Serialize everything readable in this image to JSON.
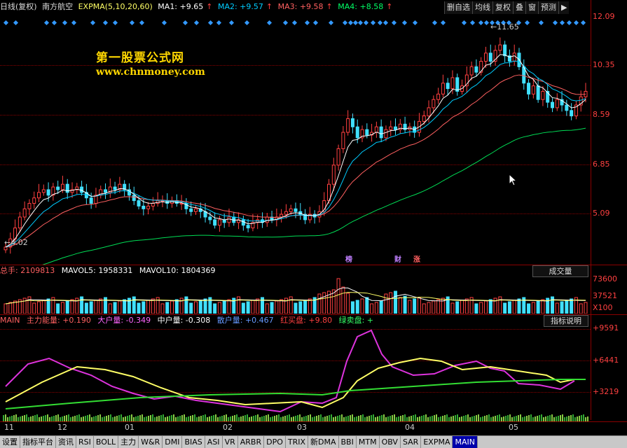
{
  "header": {
    "period": "日线(复权)",
    "stock": "南方航空",
    "indicator": "EXPMA(5,10,20,60)",
    "ma1": "MA1: +9.65",
    "ma2": "MA2: +9.57",
    "ma3": "MA3: +9.58",
    "ma4": "MA4: +8.58",
    "colors": {
      "ma1": "#ffffff",
      "ma2": "#00ccff",
      "ma3": "#ff6060",
      "ma4": "#00ff66"
    }
  },
  "toolbar": {
    "buttons": [
      "删自选",
      "均线",
      "复权",
      "叠",
      "窗",
      "预测"
    ],
    "arrow": "▶"
  },
  "watermark": {
    "line1": "第一股票公式网",
    "line2": "www.chnmoney.com"
  },
  "price_axis": {
    "ticks": [
      "12.09",
      "10.35",
      "8.59",
      "6.85",
      "5.09"
    ]
  },
  "price_annotations": {
    "high": "11.65",
    "low": "4.02"
  },
  "event_markers": [
    {
      "text": "榜",
      "color": "#c080ff"
    },
    {
      "text": "财",
      "color": "#c080ff"
    },
    {
      "text": "涨",
      "color": "#ff6060"
    }
  ],
  "volume_panel": {
    "total": "总手: 2109813",
    "mavol5": "MAVOL5: 1958331",
    "mavol10": "MAVOL10: 1804369",
    "dropdown": "成交量",
    "ticks": [
      "73600",
      "37521",
      "X100"
    ]
  },
  "main_panel": {
    "name": "MAIN",
    "i1": "主力能量: +0.190",
    "i2": "大户量: -0.349",
    "i3": "中户量: -0.308",
    "i4": "散户量: +0.467",
    "i5": "红买盘: +9.80",
    "i6": "绿卖盘: +",
    "button": "指标说明",
    "ticks": [
      "+9591",
      "+6441",
      "+3219"
    ]
  },
  "x_axis": {
    "labels": [
      "11",
      "12",
      "01",
      "02",
      "03",
      "04",
      "05"
    ]
  },
  "bottom_tabs": [
    "设置",
    "指标平台",
    "资讯",
    "RSI",
    "BOLL",
    "主力",
    "W&R",
    "DMI",
    "BIAS",
    "ASI",
    "VR",
    "ARBR",
    "DPO",
    "TRIX",
    "新DMA",
    "BBI",
    "MTM",
    "OBV",
    "SAR",
    "EXPMA",
    "MAIN"
  ],
  "chart_data": [
    {
      "type": "candlestick",
      "title": "",
      "ylim": [
        4.02,
        12.09
      ],
      "x_labels": [
        "11",
        "12",
        "01",
        "02",
        "03",
        "04",
        "05"
      ],
      "close": [
        4.2,
        4.5,
        4.9,
        5.3,
        5.6,
        5.8,
        6.0,
        6.2,
        6.3,
        6.1,
        6.4,
        6.3,
        6.5,
        6.2,
        6.3,
        6.4,
        6.2,
        6.0,
        5.8,
        6.1,
        6.3,
        6.2,
        6.4,
        6.3,
        6.5,
        6.3,
        6.1,
        5.9,
        5.7,
        5.6,
        5.7,
        5.8,
        5.9,
        5.9,
        5.8,
        5.9,
        5.8,
        5.8,
        5.6,
        5.5,
        5.6,
        5.5,
        5.3,
        5.2,
        5.0,
        5.2,
        5.1,
        5.3,
        5.1,
        5.2,
        5.0,
        4.9,
        5.1,
        5.2,
        5.1,
        5.3,
        5.2,
        5.3,
        5.4,
        5.5,
        5.6,
        5.5,
        5.4,
        5.2,
        5.4,
        5.3,
        5.5,
        5.9,
        6.5,
        7.2,
        7.8,
        8.4,
        8.9,
        8.6,
        8.2,
        8.5,
        8.3,
        8.4,
        8.6,
        8.2,
        8.5,
        8.6,
        8.5,
        8.7,
        8.5,
        8.6,
        8.4,
        8.8,
        9.0,
        9.3,
        9.6,
        9.8,
        10.2,
        10.0,
        10.4,
        9.9,
        10.1,
        10.5,
        10.8,
        10.6,
        11.0,
        11.3,
        11.0,
        11.4,
        11.6,
        11.2,
        11.0,
        11.3,
        10.8,
        10.2,
        9.8,
        10.1,
        9.6,
        9.9,
        9.5,
        9.3,
        9.6,
        9.4,
        9.2,
        9.0,
        9.4,
        9.7,
        9.9
      ],
      "series": [
        {
          "name": "MA1",
          "values": [
            9.65
          ]
        },
        {
          "name": "MA2",
          "values": [
            9.57
          ]
        },
        {
          "name": "MA3",
          "values": [
            9.58
          ]
        },
        {
          "name": "MA4",
          "values": [
            8.58
          ]
        }
      ]
    },
    {
      "type": "bar",
      "title": "",
      "ylim": [
        0,
        73600
      ],
      "series": [
        {
          "name": "MAVOL5",
          "values": [
            1958331
          ]
        },
        {
          "name": "MAVOL10",
          "values": [
            1804369
          ]
        }
      ],
      "total": 2109813
    },
    {
      "type": "line",
      "title": "",
      "ylim": [
        0,
        9591
      ],
      "series": [
        {
          "name": "主力能量",
          "values": [
            0.19
          ]
        },
        {
          "name": "大户量",
          "values": [
            -0.349
          ]
        },
        {
          "name": "中户量",
          "values": [
            -0.308
          ]
        },
        {
          "name": "散户量",
          "values": [
            0.467
          ]
        },
        {
          "name": "红买盘",
          "values": [
            9.8
          ]
        }
      ]
    }
  ]
}
